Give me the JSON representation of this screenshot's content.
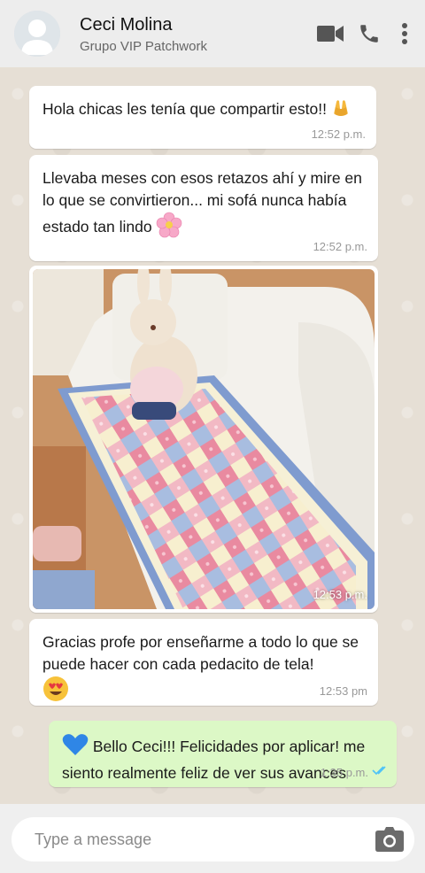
{
  "header": {
    "contact_name": "Ceci Molina",
    "contact_subtitle": "Grupo VIP Patchwork",
    "icons": [
      "avatar",
      "video-call-icon",
      "phone-icon",
      "more-vert-icon"
    ]
  },
  "messages": [
    {
      "direction": "in",
      "text": "Hola chicas les tenía que compartir esto!!",
      "emoji": "raising-hands",
      "time": "12:52 p.m."
    },
    {
      "direction": "in",
      "text": "Llevaba meses con esos retazos ahí y mire en lo que se convirtieron... mi sofá nunca había estado tan lindo",
      "emoji": "cherry-blossom",
      "time": "12:52 p.m."
    },
    {
      "direction": "in",
      "type": "image",
      "image_desc": "photo of patchwork quilt on a white sofa with a plush bunny",
      "time": "12:53 p.m."
    },
    {
      "direction": "in",
      "text": "Gracias profe por enseñarme a todo lo que se puede hacer con cada pedacito de tela!",
      "emoji": "heart-eyes",
      "time": "12:53 pm"
    },
    {
      "direction": "out",
      "text": "Bello Ceci!!! Felicidades por aplicar! me siento realmente feliz de ver sus avances",
      "emoji": "blue-heart",
      "time": "1:35 p.m.",
      "status": "read"
    }
  ],
  "composer": {
    "placeholder": "Type a message"
  },
  "colors": {
    "header_bg": "#ededed",
    "chat_bg": "#e6dfd5",
    "outgoing_bubble": "#dcf8c6",
    "incoming_bubble": "#ffffff",
    "read_ticks": "#4fc3f7"
  }
}
